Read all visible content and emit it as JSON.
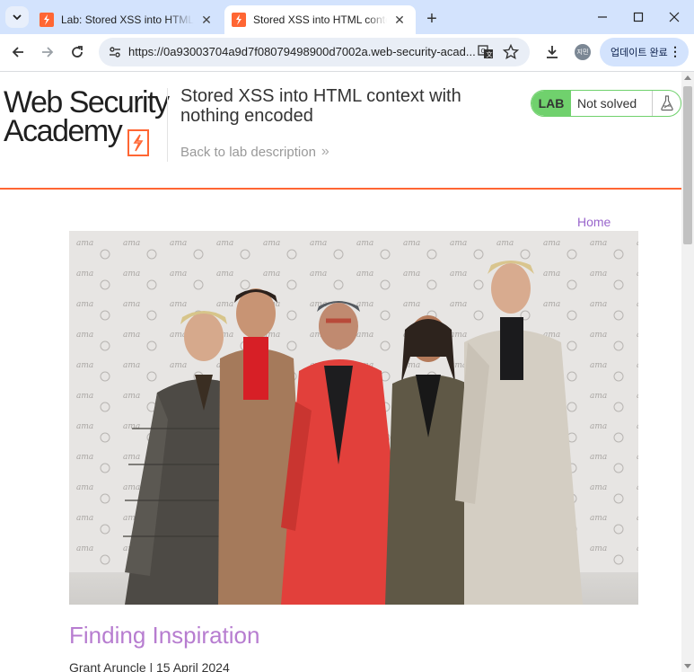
{
  "browser": {
    "tabs": [
      {
        "title": "Lab: Stored XSS into HTML context with nothing encoded",
        "active": false
      },
      {
        "title": "Stored XSS into HTML context with nothing encoded",
        "active": true
      }
    ],
    "url": "https://0a93003704a9d7f08079498900d7002a.web-security-acad...",
    "profile_initials": "지민",
    "update_button_label": "업데이트 완료",
    "colors": {
      "tabstrip": "#d3e3fd",
      "omnibox": "#e9eef6",
      "favicon": "#ff6633"
    }
  },
  "lab": {
    "logo_line1": "Web Security",
    "logo_line2": "Academy",
    "title": "Stored XSS into HTML context with nothing encoded",
    "back_link": "Back to lab description",
    "badge": "LAB",
    "status": "Not solved",
    "colors": {
      "accent": "#ff6633",
      "status_green": "#70d16d"
    }
  },
  "page": {
    "home_link": "Home",
    "post": {
      "title": "Finding Inspiration",
      "meta": "Grant Aruncle | 15 April 2024"
    },
    "colors": {
      "link": "#9966cc",
      "post_title": "#b77dd0"
    }
  }
}
